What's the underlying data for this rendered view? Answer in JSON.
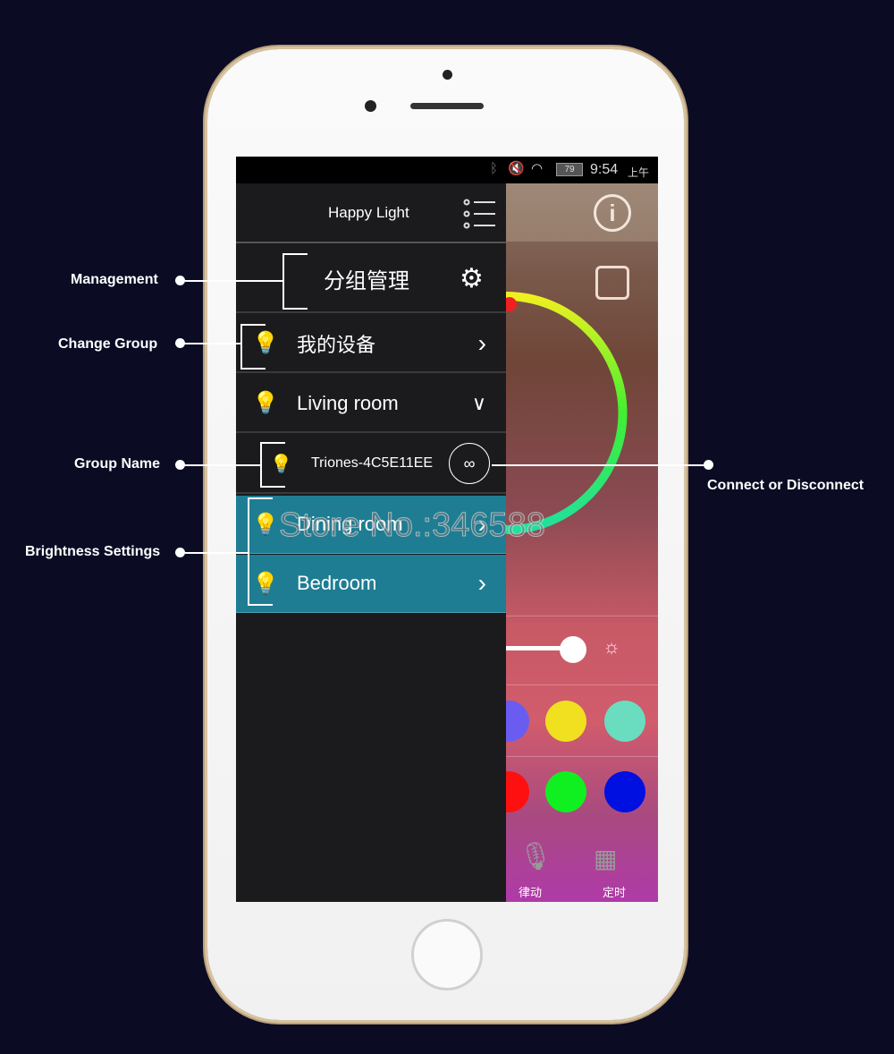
{
  "status_bar": {
    "battery": "79",
    "time": "9:54",
    "ampm": "上午"
  },
  "sidebar": {
    "title": "Happy Light",
    "management": "分组管理",
    "my_devices": "我的设备",
    "groups": [
      {
        "label": "Living room",
        "expanded": true
      },
      {
        "label": "Dining room",
        "expanded": false
      },
      {
        "label": "Bedroom",
        "expanded": false
      }
    ],
    "device": "Triones-4C5E11EE"
  },
  "annotations": {
    "management": "Management",
    "change_group": "Change Group",
    "group_name": "Group Name",
    "brightness": "Brightness Settings",
    "connect": "Connect or Disconnect"
  },
  "watermark": "Store No.:346588",
  "main": {
    "preset_colors": [
      "#6a5cf0",
      "#f0e020",
      "#6adcc0",
      "#ff1010",
      "#10f020",
      "#0010e0"
    ],
    "bottom_tabs": [
      {
        "label": "律动",
        "icon": "microphone-icon"
      },
      {
        "label": "定时",
        "icon": "calendar-clock-icon"
      }
    ]
  }
}
